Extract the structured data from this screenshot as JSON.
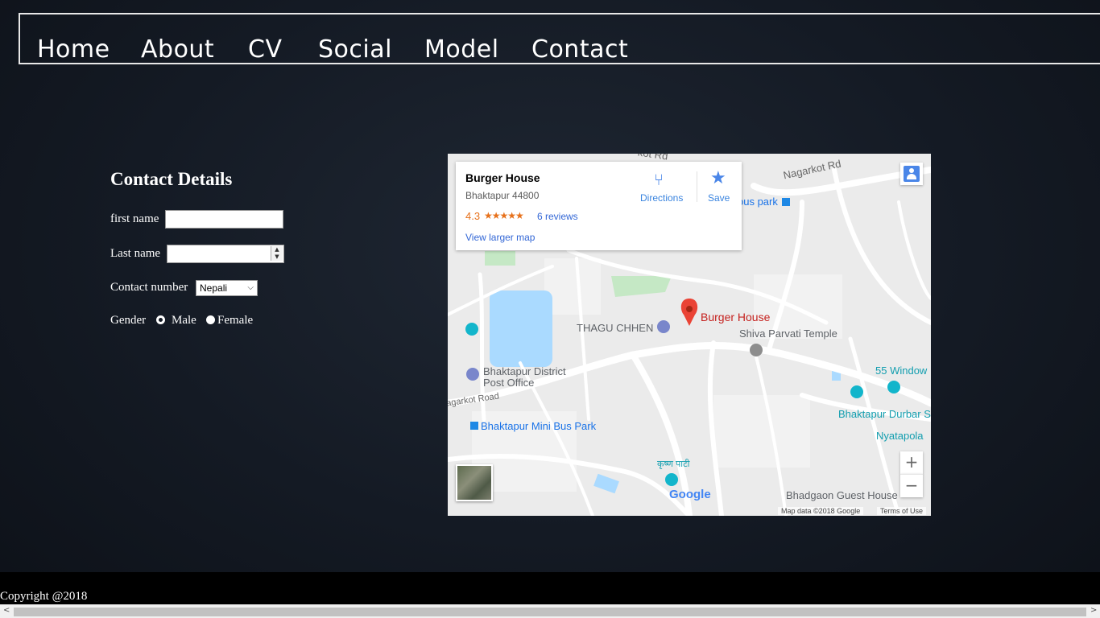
{
  "nav": {
    "items": [
      {
        "label": "Home"
      },
      {
        "label": "About"
      },
      {
        "label": "CV"
      },
      {
        "label": "Social"
      },
      {
        "label": "Model"
      },
      {
        "label": "Contact"
      }
    ]
  },
  "contact": {
    "title": "Contact Details",
    "first_name_label": "first name",
    "first_name_value": "",
    "last_name_label": "Last name",
    "last_name_value": "",
    "contact_number_label": "Contact number",
    "contact_number_selected": "Nepali",
    "gender_label": "Gender",
    "gender_options": [
      {
        "label": "Male",
        "checked": false
      },
      {
        "label": "Female",
        "checked": false
      }
    ]
  },
  "map": {
    "place_name": "Burger House",
    "place_address": "Bhaktapur 44800",
    "rating": "4.3",
    "stars": "★★★★★",
    "reviews": "6 reviews",
    "view_larger": "View larger map",
    "directions_label": "Directions",
    "save_label": "Save",
    "labels": {
      "nagarkot_rd_top": "Nagarkot Rd",
      "kot_rd": "kot Rd",
      "bus_park": "ous park",
      "burger_house": "Burger House",
      "thagu_chhen": "THAGU CHHEN",
      "shiva_parvati": "Shiva Parvati Temple",
      "post_office_1": "Bhaktapur District",
      "post_office_2": "Post Office",
      "nagarkot_road": "agarkot Road",
      "mini_bus_park": "Bhaktapur Mini Bus Park",
      "windows": "55 Window",
      "durbar": "Bhaktapur Durbar S",
      "nyatapola": "Nyatapola",
      "krishna": "कृष्ण पाटी",
      "guest_house": "Bhadgaon Guest House",
      "google": "Google",
      "map_data": "Map data ©2018 Google",
      "terms": "Terms of Use"
    },
    "zoom_in": "+",
    "zoom_out": "−"
  },
  "footer": {
    "copyright": "Copyright @2018"
  },
  "colors": {
    "accent_orange": "#e7711b",
    "link_blue": "#3367d6",
    "marker_red": "#db4437",
    "water": "#aadaff",
    "park": "#c5e8c5"
  }
}
